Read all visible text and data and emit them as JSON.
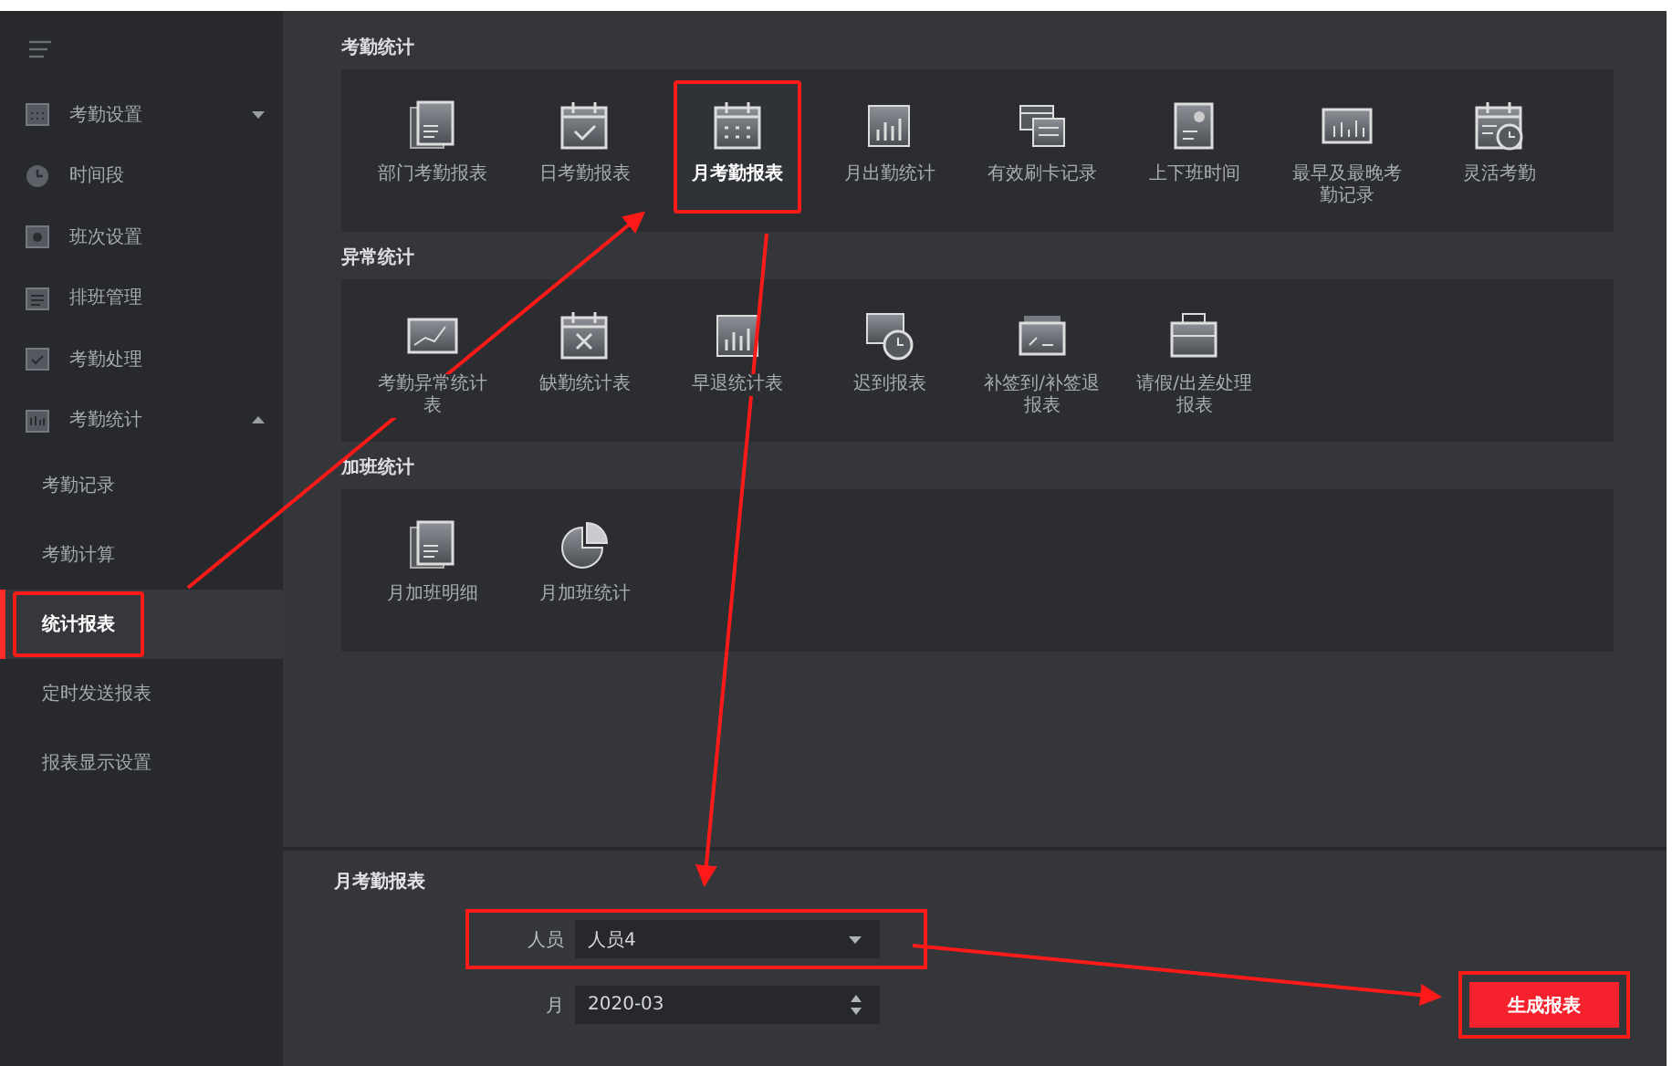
{
  "sidebar": {
    "items": [
      {
        "label": "考勤设置",
        "expanded": false,
        "selected": false
      },
      {
        "label": "时间段",
        "selected": false
      },
      {
        "label": "班次设置",
        "selected": false
      },
      {
        "label": "排班管理",
        "selected": false
      },
      {
        "label": "考勤处理",
        "selected": false
      },
      {
        "label": "考勤统计",
        "expanded": true,
        "selected": false,
        "children": [
          {
            "label": "考勤记录",
            "selected": false,
            "highlighted": false
          },
          {
            "label": "考勤计算",
            "selected": false,
            "highlighted": false
          },
          {
            "label": "统计报表",
            "selected": true,
            "highlighted": true
          },
          {
            "label": "定时发送报表",
            "selected": false,
            "highlighted": false
          },
          {
            "label": "报表显示设置",
            "selected": false,
            "highlighted": false
          }
        ]
      }
    ]
  },
  "sections": [
    {
      "title": "考勤统计",
      "items": [
        {
          "label": "部门考勤报表",
          "selected": false,
          "highlighted": false
        },
        {
          "label": "日考勤报表",
          "selected": false,
          "highlighted": false
        },
        {
          "label": "月考勤报表",
          "selected": true,
          "highlighted": true
        },
        {
          "label": "月出勤统计",
          "selected": false,
          "highlighted": false
        },
        {
          "label": "有效刷卡记录",
          "selected": false,
          "highlighted": false
        },
        {
          "label": "上下班时间",
          "selected": false,
          "highlighted": false
        },
        {
          "label": "最早及最晚考勤记录",
          "selected": false,
          "highlighted": false
        },
        {
          "label": "灵活考勤",
          "selected": false,
          "highlighted": false
        }
      ]
    },
    {
      "title": "异常统计",
      "items": [
        {
          "label": "考勤异常统计表",
          "selected": false,
          "highlighted": false
        },
        {
          "label": "缺勤统计表",
          "selected": false,
          "highlighted": false
        },
        {
          "label": "早退统计表",
          "selected": false,
          "highlighted": false
        },
        {
          "label": "迟到报表",
          "selected": false,
          "highlighted": false
        },
        {
          "label": "补签到/补签退报表",
          "selected": false,
          "highlighted": false
        },
        {
          "label": "请假/出差处理报表",
          "selected": false,
          "highlighted": false
        }
      ]
    },
    {
      "title": "加班统计",
      "items": [
        {
          "label": "月加班明细",
          "selected": false,
          "highlighted": false
        },
        {
          "label": "月加班统计",
          "selected": false,
          "highlighted": false
        }
      ]
    }
  ],
  "report_panel": {
    "title": "月考勤报表",
    "fields": [
      {
        "label": "人员",
        "kind": "select",
        "value": "人员4",
        "highlighted": true
      },
      {
        "label": "月",
        "kind": "spinner",
        "value": "2020-03",
        "highlighted": false
      }
    ],
    "generate_button": {
      "label": "生成报表",
      "highlighted": true
    }
  }
}
